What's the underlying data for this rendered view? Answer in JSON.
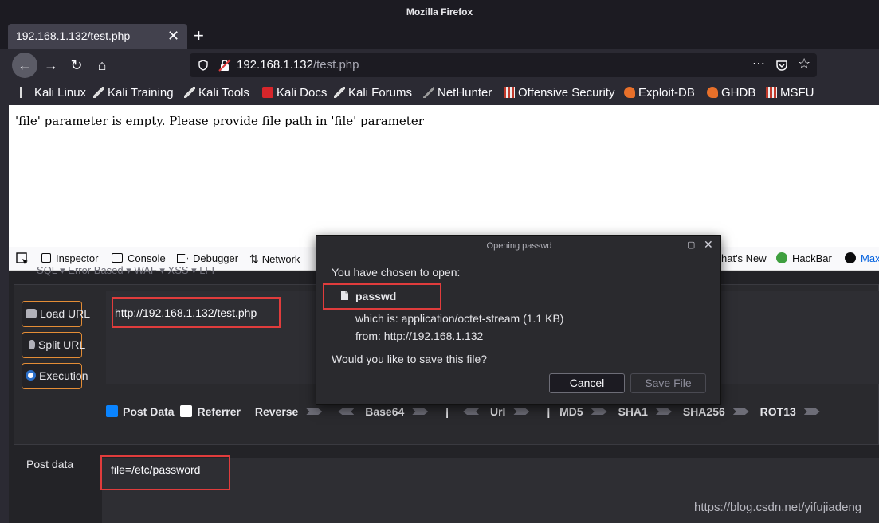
{
  "window": {
    "title": "Mozilla Firefox"
  },
  "tab": {
    "title": "192.168.1.132/test.php",
    "close_glyph": "✕",
    "new_tab_glyph": "+"
  },
  "nav": {
    "back_glyph": "←",
    "forward_glyph": "→",
    "reload_glyph": "↻",
    "home_glyph": "⌂",
    "url_host": "192.168.1.132",
    "url_path": "/test.php",
    "more_glyph": "⋯",
    "star_glyph": "☆"
  },
  "bookmarks": [
    "Kali Linux",
    "Kali Training",
    "Kali Tools",
    "Kali Docs",
    "Kali Forums",
    "NetHunter",
    "Offensive Security",
    "Exploit-DB",
    "GHDB",
    "MSFU"
  ],
  "page": {
    "message": "'file' parameter is empty. Please provide file path in 'file' parameter"
  },
  "devtools": {
    "tabs": [
      "Inspector",
      "Console",
      "Debugger",
      "Network"
    ],
    "right_tabs": [
      "hat's New",
      "HackBar",
      "Max"
    ]
  },
  "hackbar": {
    "menu": "SQL ▾     Error Based ▾     WAF ▾     XSS ▾     LFI",
    "buttons": {
      "load": "Load URL",
      "split": "Split URL",
      "execute": "Execution"
    },
    "url_value": "http://192.168.1.132/test.php",
    "options": {
      "post_data": "Post Data",
      "referrer": "Referrer",
      "reverse": "Reverse",
      "base64": "Base64",
      "url": "Url",
      "md5": "MD5",
      "sha1": "SHA1",
      "sha256": "SHA256",
      "rot13": "ROT13",
      "sep": "|"
    },
    "post_label": "Post data",
    "post_value": "file=/etc/password"
  },
  "dialog": {
    "title": "Opening passwd",
    "chosen": "You have chosen to open:",
    "filename": "passwd",
    "which_is": "which is: application/octet-stream (1.1 KB)",
    "from": "from:  http://192.168.1.132",
    "question": "Would you like to save this file?",
    "cancel": "Cancel",
    "save": "Save File",
    "max_glyph": "▢",
    "close_glyph": "✕"
  },
  "watermark": "https://blog.csdn.net/yifujiadeng",
  "colors": {
    "accent_red": "#e03c3c",
    "hackbar_orange": "#e48d36",
    "check_blue": "#0a84ff"
  }
}
